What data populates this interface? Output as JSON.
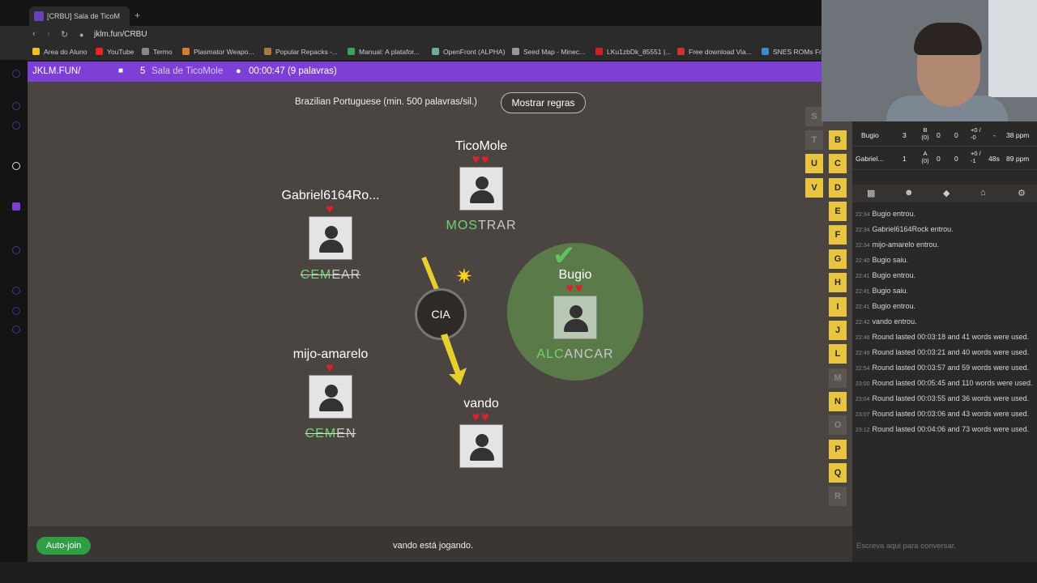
{
  "browser": {
    "tab_title": "[CRBU] Sala de TicoM",
    "new_tab": "+",
    "url": "jklm.fun/CRBU",
    "bookmarks": [
      "Area do Aluno",
      "YouTube",
      "Termo",
      "Plasmator Weapo...",
      "Popular Repacks -...",
      "Manual: A platafor...",
      "OpenFront (ALPHA)",
      "Seed Map - Minec...",
      "LKu1zbDk_85551 |...",
      "Free download Via...",
      "SNES ROMs Fre"
    ]
  },
  "header": {
    "site": "JKLM.FUN/",
    "player_count": "5",
    "room_name": "Sala de TicoMole",
    "timer": "00:00:47 (9 palavras)"
  },
  "game": {
    "language_info": "Brazilian Portuguese (min. 500 palavras/sil.)",
    "rules_button": "Mostrar regras",
    "syllable": "CIA",
    "players": [
      {
        "name": "TicoMole",
        "hearts": "♥♥",
        "word_ok": "MOS",
        "word_rest": "TRAR",
        "strike": false
      },
      {
        "name": "Gabriel6164Ro...",
        "hearts": "♥",
        "word_ok": "CEM",
        "word_rest": "EAR",
        "strike": true
      },
      {
        "name": "Bugio",
        "hearts": "♥♥",
        "word_ok": "ALC",
        "word_rest": "ANCAR",
        "strike": false
      },
      {
        "name": "mijo-amarelo",
        "hearts": "♥",
        "word_ok": "CEM",
        "word_rest": "EN",
        "strike": true
      },
      {
        "name": "vando",
        "hearts": "♥♥",
        "word_ok": "",
        "word_rest": "",
        "strike": false
      }
    ],
    "letters": {
      "S": false,
      "T": false,
      "B": true,
      "U": true,
      "C": true,
      "V": true,
      "D": true,
      "E": true,
      "F": true,
      "G": true,
      "H": true,
      "I": true,
      "J": true,
      "L": true,
      "M": false,
      "N": true,
      "O": false,
      "P": true,
      "Q": true,
      "R": false
    }
  },
  "bottom": {
    "auto_join": "Auto-join",
    "status": "vando está jogando."
  },
  "scoreboard": [
    {
      "name": "Bugio",
      "lives": "3",
      "c1": "B (0)",
      "c2": "0",
      "c3": "0",
      "c4": "+0 / -0",
      "c5": "-",
      "c6": "38 ppm"
    },
    {
      "name": "Gabriel...",
      "lives": "1",
      "c1": "A (0)",
      "c2": "0",
      "c3": "0",
      "c4": "+0 / -1",
      "c5": "48s",
      "c6": "89 ppm"
    }
  ],
  "chat": {
    "messages": [
      {
        "time": "22:34",
        "text": "Bugio entrou."
      },
      {
        "time": "22:34",
        "text": "Gabriel6164Rock entrou."
      },
      {
        "time": "22:34",
        "text": "mijo-amarelo entrou."
      },
      {
        "time": "22:40",
        "text": "Bugio saiu."
      },
      {
        "time": "22:41",
        "text": "Bugio entrou."
      },
      {
        "time": "22:41",
        "text": "Bugio saiu."
      },
      {
        "time": "22:41",
        "text": "Bugio entrou."
      },
      {
        "time": "22:42",
        "text": "vando entrou."
      },
      {
        "time": "22:46",
        "text": "Round lasted 00:03:18 and 41 words were used."
      },
      {
        "time": "22:49",
        "text": "Round lasted 00:03:21 and 40 words were used."
      },
      {
        "time": "22:54",
        "text": "Round lasted 00:03:57 and 59 words were used."
      },
      {
        "time": "23:00",
        "text": "Round lasted 00:05:45 and 110 words were used."
      },
      {
        "time": "23:04",
        "text": "Round lasted 00:03:55 and 36 words were used."
      },
      {
        "time": "23:07",
        "text": "Round lasted 00:03:06 and 43 words were used."
      },
      {
        "time": "23:12",
        "text": "Round lasted 00:04:06 and 73 words were used."
      }
    ],
    "input_placeholder": "Escreva aqui para conversar."
  }
}
